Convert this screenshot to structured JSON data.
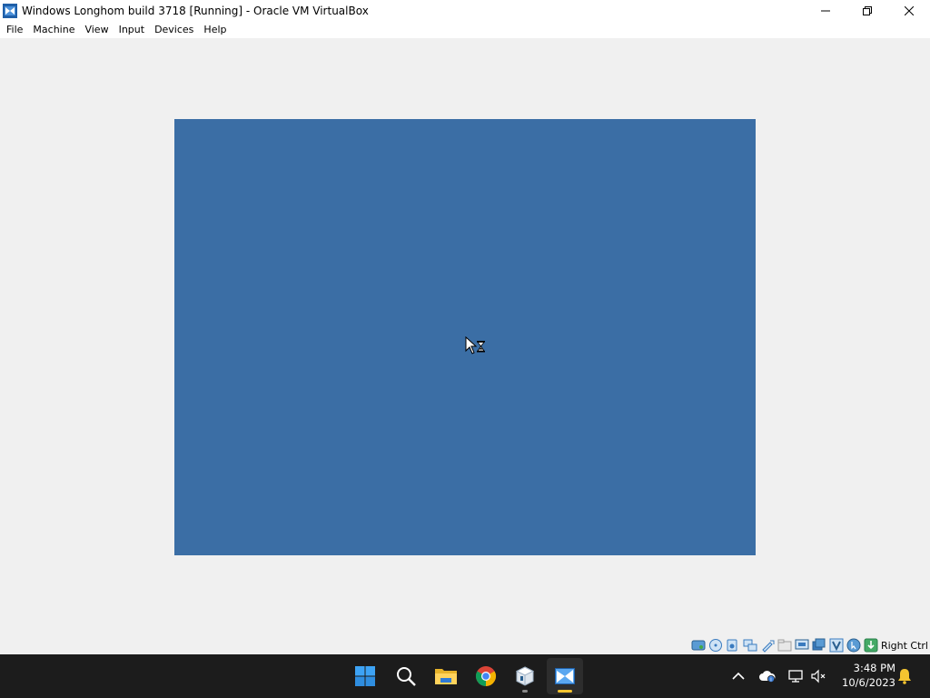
{
  "window": {
    "title": "Windows Longhom build 3718 [Running] - Oracle VM VirtualBox",
    "controls": [
      "minimize",
      "restore",
      "close"
    ]
  },
  "menubar": {
    "items": [
      "File",
      "Machine",
      "View",
      "Input",
      "Devices",
      "Help"
    ]
  },
  "vm_display": {
    "background_color": "#3b6ea5",
    "cursor": "arrow-hourglass-busy"
  },
  "statusbar": {
    "icons": [
      "hard-disk-icon",
      "optical-drive-icon",
      "audio-icon",
      "network-icon",
      "usb-icon",
      "shared-folders-icon",
      "display-icon",
      "recording-icon",
      "virtualization-icon",
      "mouse-integration-icon",
      "keyboard-capture-icon"
    ],
    "host_key": "Right Ctrl"
  },
  "taskbar": {
    "apps": [
      {
        "name": "start",
        "active": false,
        "running": false
      },
      {
        "name": "search",
        "active": false,
        "running": false
      },
      {
        "name": "file-explorer",
        "active": false,
        "running": false
      },
      {
        "name": "chrome",
        "active": false,
        "running": false
      },
      {
        "name": "virtualbox-manager",
        "active": false,
        "running": true
      },
      {
        "name": "virtualbox-vm",
        "active": true,
        "running": true
      }
    ],
    "tray": {
      "icons": [
        "chevron-up-icon",
        "onedrive-icon",
        "network-icon",
        "volume-muted-icon"
      ],
      "time": "3:48 PM",
      "date": "10/6/2023",
      "notification_icon": "bell-icon"
    }
  },
  "colors": {
    "vm_background": "#3b6ea5",
    "taskbar": "#1c1c1c",
    "window_bg": "#f0f0f0"
  }
}
